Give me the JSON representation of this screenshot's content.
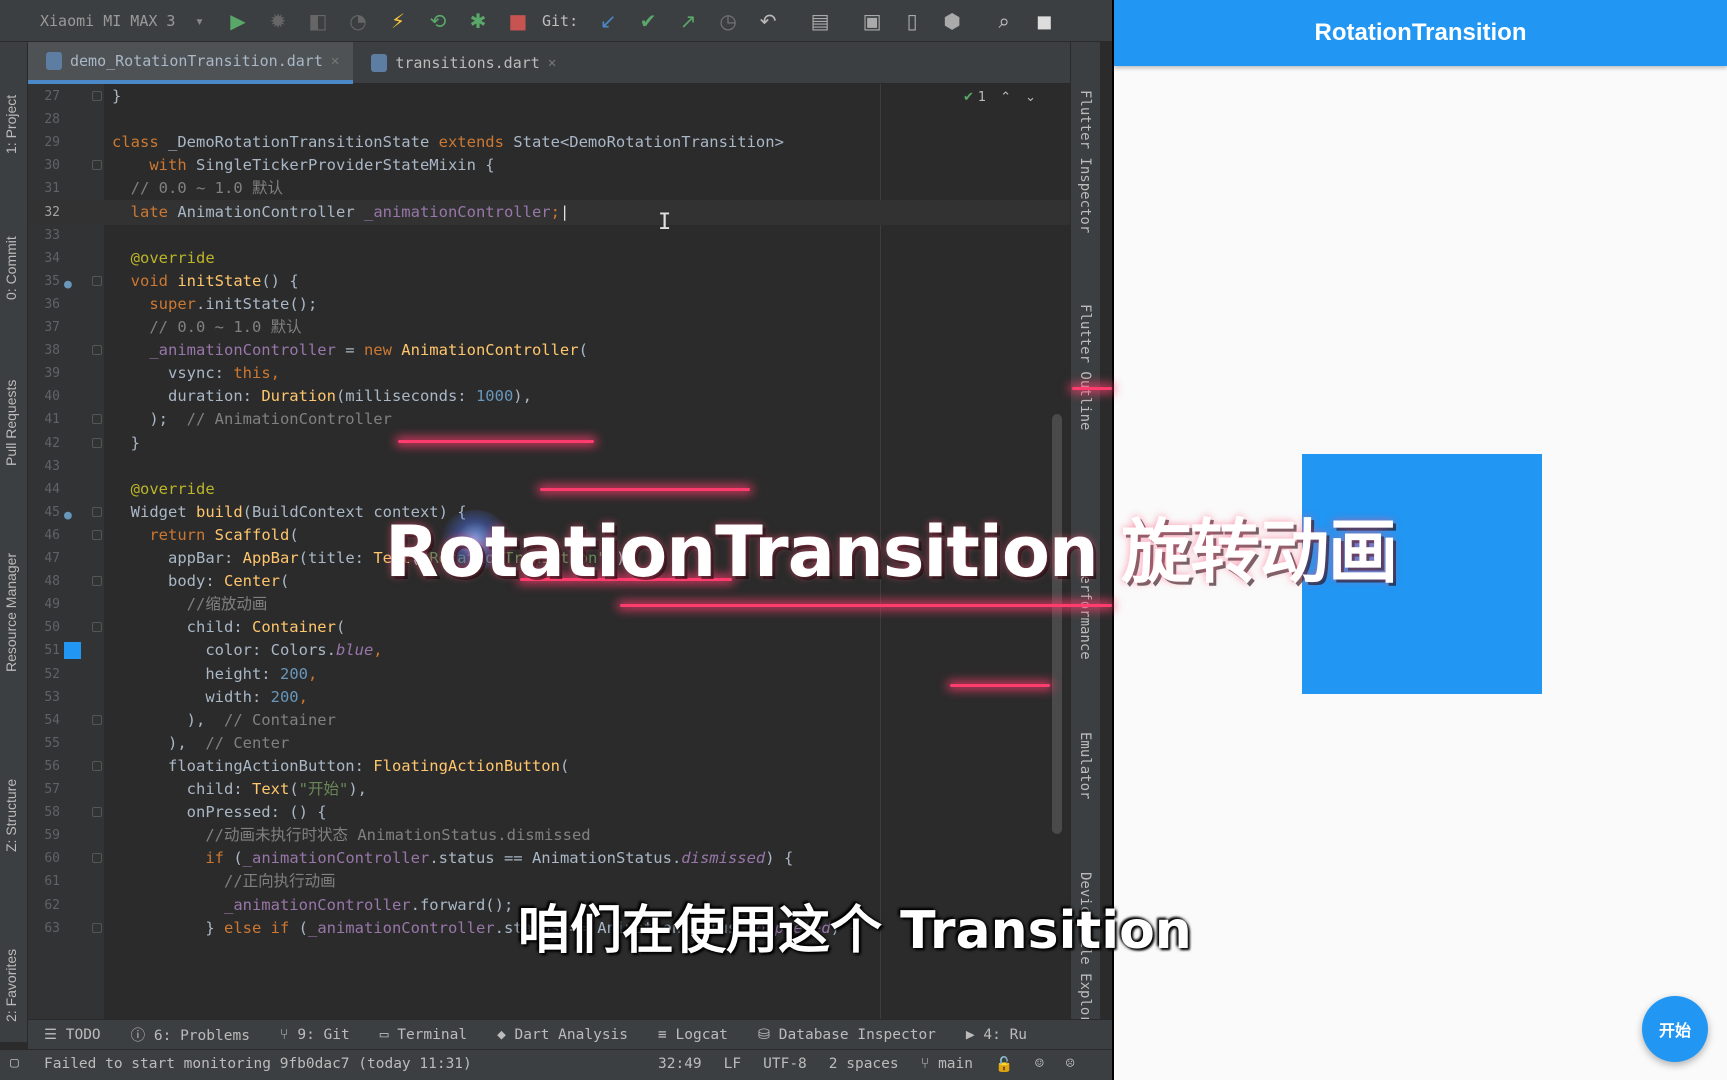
{
  "toolbar": {
    "device": "Xiaomi MI MAX 3",
    "git_label": "Git:"
  },
  "left_panels": [
    "1: Project",
    "0: Commit",
    "Pull Requests",
    "Resource Manager",
    "Z: Structure",
    "2: Favorites"
  ],
  "right_panels": [
    "Flutter Inspector",
    "Flutter Outline",
    "Performance",
    "Emulator",
    "Device File Explorer"
  ],
  "tabs": [
    {
      "label": "demo_RotationTransition.dart",
      "active": true
    },
    {
      "label": "transitions.dart",
      "active": false
    }
  ],
  "editor": {
    "inspection_count": "1",
    "lines": [
      {
        "n": "27",
        "tokens": [
          [
            "}",
            ""
          ]
        ]
      },
      {
        "n": "28",
        "tokens": []
      },
      {
        "n": "29",
        "tokens": [
          [
            "class ",
            "kw"
          ],
          [
            "_DemoRotationTransitionState ",
            ""
          ],
          [
            "extends ",
            "kw"
          ],
          [
            "State<DemoRotationTransition>",
            ""
          ]
        ]
      },
      {
        "n": "30",
        "tokens": [
          [
            "    ",
            ""
          ],
          [
            "with ",
            "kw"
          ],
          [
            "SingleTickerProviderStateMixin {",
            ""
          ]
        ]
      },
      {
        "n": "31",
        "tokens": [
          [
            "  ",
            ""
          ],
          [
            "// 0.0 ~ 1.0 默认",
            "cm"
          ]
        ]
      },
      {
        "n": "32",
        "tokens": [
          [
            "  ",
            ""
          ],
          [
            "late ",
            "kw"
          ],
          [
            "AnimationController ",
            ""
          ],
          [
            "_animationController",
            "fl"
          ],
          [
            ";",
            "kw"
          ]
        ],
        "current": true
      },
      {
        "n": "33",
        "tokens": []
      },
      {
        "n": "34",
        "tokens": [
          [
            "  ",
            ""
          ],
          [
            "@override",
            "an"
          ]
        ]
      },
      {
        "n": "35",
        "tokens": [
          [
            "  ",
            ""
          ],
          [
            "void ",
            "kw"
          ],
          [
            "initState",
            "fn"
          ],
          [
            "() {",
            ""
          ]
        ]
      },
      {
        "n": "36",
        "tokens": [
          [
            "    ",
            ""
          ],
          [
            "super",
            "kw"
          ],
          [
            ".initState();",
            ""
          ]
        ]
      },
      {
        "n": "37",
        "tokens": [
          [
            "    ",
            ""
          ],
          [
            "// 0.0 ~ 1.0 默认",
            "cm"
          ]
        ]
      },
      {
        "n": "38",
        "tokens": [
          [
            "    ",
            ""
          ],
          [
            "_animationController",
            "fl"
          ],
          [
            " = ",
            ""
          ],
          [
            "new ",
            "kw"
          ],
          [
            "AnimationController",
            "fn"
          ],
          [
            "(",
            ""
          ]
        ]
      },
      {
        "n": "39",
        "tokens": [
          [
            "      vsync: ",
            ""
          ],
          [
            "this",
            "kw"
          ],
          [
            ",",
            "kw"
          ]
        ]
      },
      {
        "n": "40",
        "tokens": [
          [
            "      duration: ",
            ""
          ],
          [
            "Duration",
            "fn"
          ],
          [
            "(milliseconds: ",
            ""
          ],
          [
            "1000",
            "nm"
          ],
          [
            "),",
            ""
          ]
        ]
      },
      {
        "n": "41",
        "tokens": [
          [
            "    );  ",
            ""
          ],
          [
            "// AnimationController",
            "cm"
          ]
        ]
      },
      {
        "n": "42",
        "tokens": [
          [
            "  }",
            ""
          ]
        ]
      },
      {
        "n": "43",
        "tokens": []
      },
      {
        "n": "44",
        "tokens": [
          [
            "  ",
            ""
          ],
          [
            "@override",
            "an"
          ]
        ]
      },
      {
        "n": "45",
        "tokens": [
          [
            "  Widget ",
            ""
          ],
          [
            "build",
            "fn"
          ],
          [
            "(BuildContext context) {",
            ""
          ]
        ]
      },
      {
        "n": "46",
        "tokens": [
          [
            "    ",
            ""
          ],
          [
            "return ",
            "kw"
          ],
          [
            "Scaffold",
            "fn"
          ],
          [
            "(",
            ""
          ]
        ]
      },
      {
        "n": "47",
        "tokens": [
          [
            "      appBar: ",
            ""
          ],
          [
            "AppBar",
            "fn"
          ],
          [
            "(title: ",
            ""
          ],
          [
            "Text",
            "fn"
          ],
          [
            "(",
            ""
          ],
          [
            "\"RotationTransition\"",
            "st"
          ],
          [
            ")),",
            ""
          ]
        ]
      },
      {
        "n": "48",
        "tokens": [
          [
            "      body: ",
            ""
          ],
          [
            "Center",
            "fn"
          ],
          [
            "(",
            ""
          ]
        ]
      },
      {
        "n": "49",
        "tokens": [
          [
            "        ",
            ""
          ],
          [
            "//缩放动画",
            "cm"
          ]
        ]
      },
      {
        "n": "50",
        "tokens": [
          [
            "        child: ",
            ""
          ],
          [
            "Container",
            "fn"
          ],
          [
            "(",
            ""
          ]
        ]
      },
      {
        "n": "51",
        "tokens": [
          [
            "          color: Colors.",
            ""
          ],
          [
            "blue",
            "it"
          ],
          [
            ",",
            "kw"
          ]
        ],
        "swatch": true
      },
      {
        "n": "52",
        "tokens": [
          [
            "          height: ",
            ""
          ],
          [
            "200",
            "nm"
          ],
          [
            ",",
            "kw"
          ]
        ]
      },
      {
        "n": "53",
        "tokens": [
          [
            "          width: ",
            ""
          ],
          [
            "200",
            "nm"
          ],
          [
            ",",
            "kw"
          ]
        ]
      },
      {
        "n": "54",
        "tokens": [
          [
            "        ),  ",
            ""
          ],
          [
            "// Container",
            "cm"
          ]
        ]
      },
      {
        "n": "55",
        "tokens": [
          [
            "      ),  ",
            ""
          ],
          [
            "// Center",
            "cm"
          ]
        ]
      },
      {
        "n": "56",
        "tokens": [
          [
            "      floatingActionButton: ",
            ""
          ],
          [
            "FloatingActionButton",
            "fn"
          ],
          [
            "(",
            ""
          ]
        ]
      },
      {
        "n": "57",
        "tokens": [
          [
            "        child: ",
            ""
          ],
          [
            "Text",
            "fn"
          ],
          [
            "(",
            ""
          ],
          [
            "\"开始\"",
            "st"
          ],
          [
            "),",
            ""
          ]
        ]
      },
      {
        "n": "58",
        "tokens": [
          [
            "        onPressed: () {",
            ""
          ]
        ]
      },
      {
        "n": "59",
        "tokens": [
          [
            "          ",
            ""
          ],
          [
            "//动画未执行时状态 AnimationStatus.dismissed",
            "cm"
          ]
        ]
      },
      {
        "n": "60",
        "tokens": [
          [
            "          ",
            ""
          ],
          [
            "if ",
            "kw"
          ],
          [
            "(",
            ""
          ],
          [
            "_animationController",
            "fl"
          ],
          [
            ".status == AnimationStatus.",
            ""
          ],
          [
            "dismissed",
            "it"
          ],
          [
            ") {",
            ""
          ]
        ]
      },
      {
        "n": "61",
        "tokens": [
          [
            "            ",
            ""
          ],
          [
            "//正向执行动画",
            "cm"
          ]
        ]
      },
      {
        "n": "62",
        "tokens": [
          [
            "            ",
            ""
          ],
          [
            "_animationController",
            "fl"
          ],
          [
            ".forward();",
            ""
          ]
        ]
      },
      {
        "n": "63",
        "tokens": [
          [
            "          } ",
            ""
          ],
          [
            "else if ",
            "kw"
          ],
          [
            "(",
            ""
          ],
          [
            "_animationController",
            "fl"
          ],
          [
            ".status == AnimationStatus.",
            ""
          ],
          [
            "completed",
            "it"
          ],
          [
            ") {",
            ""
          ]
        ]
      }
    ]
  },
  "bottom_tools": [
    "TODO",
    "6: Problems",
    "9: Git",
    "Terminal",
    "Dart Analysis",
    "Logcat",
    "Database Inspector",
    "4: Ru"
  ],
  "status": {
    "message": "Failed to start monitoring 9fb0dac7 (today 11:31)",
    "position": "32:49",
    "line_sep": "LF",
    "encoding": "UTF-8",
    "indent": "2 spaces",
    "branch": "main"
  },
  "app": {
    "title": "RotationTransition",
    "fab_label": "开始",
    "accent": "#2196f3"
  },
  "overlay": {
    "title": "RotationTransition 旋转动画",
    "subtitle": "咱们在使用这个 Transition"
  }
}
